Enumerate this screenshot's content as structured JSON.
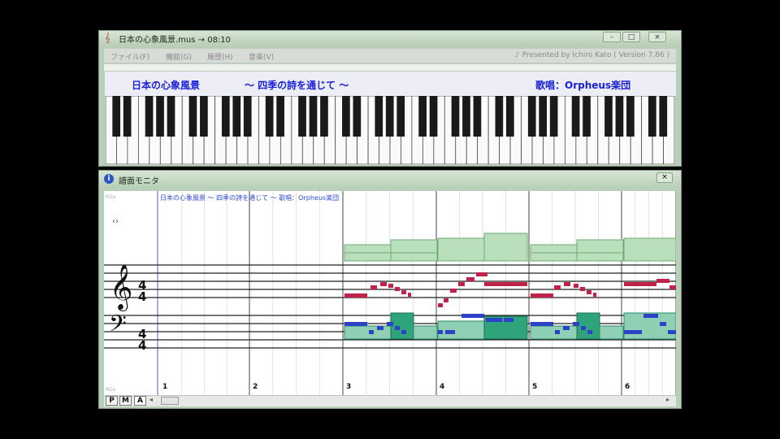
{
  "top_window": {
    "title": "日本の心象風景.mus → 08:10",
    "menu": [
      "ファイル(F)",
      "機能(G)",
      "履歴(H)",
      "音楽(V)"
    ],
    "presented_by": "♪ Presented by Ichiro Kato ( Version 7.86 )",
    "banner_left": "日本の心象風景",
    "banner_center": "～ 四季の詩を通じて ～",
    "banner_right": "歌唱：Orpheus楽団"
  },
  "bottom_window": {
    "title": "譜面モニタ",
    "caption": "日本の心象風景 ～ 四季の詩を通じて ～ 歌唱：Orpheus楽団",
    "time_signature": {
      "numerator": "4",
      "denominator": "4"
    },
    "bar_numbers": [
      "1",
      "2",
      "3",
      "4",
      "5",
      "6"
    ],
    "modes": [
      "P",
      "M",
      "A"
    ]
  },
  "icons": [
    "app-icon",
    "minimize-icon",
    "maximize-icon",
    "close-icon",
    "info-icon",
    "treble-clef-icon",
    "bass-clef-icon"
  ],
  "colors": {
    "frame": "#b9cfb7",
    "banner_text": "#1a22d8",
    "melody": "#c0224a",
    "bass": "#2c43c8",
    "chord_top": "#9fd1a4",
    "chord_bottom": "#2fa37a"
  }
}
